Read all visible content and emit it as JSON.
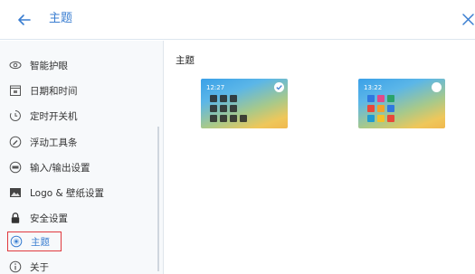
{
  "header": {
    "back_icon": "arrow-left-icon",
    "title": "主题",
    "close_icon": "close-icon"
  },
  "sidebar": {
    "items": [
      {
        "label": "智能护眼",
        "icon": "eye-protection-icon"
      },
      {
        "label": "日期和时间",
        "icon": "calendar-icon"
      },
      {
        "label": "定时开关机",
        "icon": "power-timer-icon"
      },
      {
        "label": "浮动工具条",
        "icon": "floating-toolbar-icon"
      },
      {
        "label": "输入/输出设置",
        "icon": "input-output-icon"
      },
      {
        "label": "Logo & 壁纸设置",
        "icon": "image-icon"
      },
      {
        "label": "安全设置",
        "icon": "lock-icon"
      },
      {
        "label": "主题",
        "icon": "theme-icon",
        "active": true
      },
      {
        "label": "关于",
        "icon": "info-icon"
      }
    ]
  },
  "main": {
    "section_title": "主题",
    "themes": [
      {
        "time": "12:27",
        "selected": true
      },
      {
        "time": "13:22",
        "selected": false
      }
    ]
  },
  "colors": {
    "accent": "#3a7ed1",
    "active_outline": "#e0393e",
    "sidebar_bg": "#f7f9fb"
  }
}
